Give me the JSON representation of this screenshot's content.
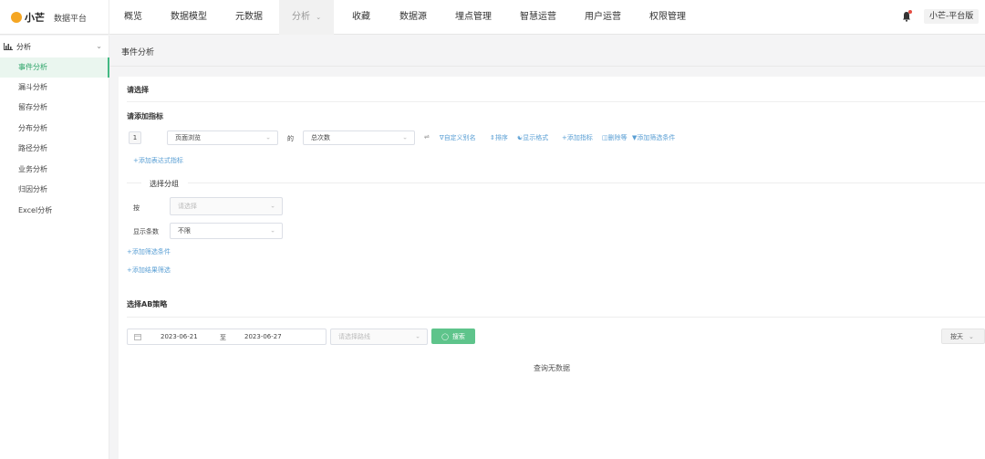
{
  "brand": {
    "name": "小芒",
    "subtitle": "数据平台",
    "logo_color": "#f5a623"
  },
  "nav": [
    {
      "label": "概览"
    },
    {
      "label": "数据模型"
    },
    {
      "label": "元数据"
    },
    {
      "label": "分析",
      "active": true,
      "icon": "chevron-down-icon"
    },
    {
      "label": "收藏"
    },
    {
      "label": "数据源"
    },
    {
      "label": "埋点管理"
    },
    {
      "label": "智慧运营"
    },
    {
      "label": "用户运营"
    },
    {
      "label": "权限管理"
    }
  ],
  "header": {
    "user": "小芒-平台版",
    "bell_icon": "bell-icon"
  },
  "sidebar": {
    "group": "分析",
    "items": [
      {
        "label": "事件分析",
        "active": true
      },
      {
        "label": "漏斗分析"
      },
      {
        "label": "留存分析"
      },
      {
        "label": "分布分析"
      },
      {
        "label": "路径分析"
      },
      {
        "label": "业务分析"
      },
      {
        "label": "归因分析"
      },
      {
        "label": "Excel分析"
      }
    ]
  },
  "page": {
    "title": "事件分析"
  },
  "form": {
    "select_heading": "请选择",
    "metric_heading": "请添加指标",
    "metric_index": "1",
    "event_select": "页面浏览",
    "of_label": "的",
    "measure_select": "总次数",
    "metric_actions": [
      "自定义别名",
      "排序",
      "显示格式",
      "添加指标",
      "删除等",
      "添加筛选条件"
    ],
    "add_expression": "+添加表达式指标",
    "group_heading": "选择分组",
    "by_label": "按",
    "by_placeholder": "请选择",
    "rows_label": "显示条数",
    "rows_value": "不限",
    "add_filter": "+添加筛选条件",
    "add_result_filter": "+添加结果筛选",
    "ab_heading": "选择AB策略"
  },
  "query": {
    "date_start": "2023-06-21",
    "date_sep": "至",
    "date_end": "2023-06-27",
    "strategy_placeholder": "请选择路线",
    "search_label": "搜索",
    "search_color": "#5ec48b",
    "unit_select": "按天",
    "empty_text": "查询无数据"
  },
  "colors": {
    "accent": "#42b983",
    "link": "#5a9fd4"
  }
}
